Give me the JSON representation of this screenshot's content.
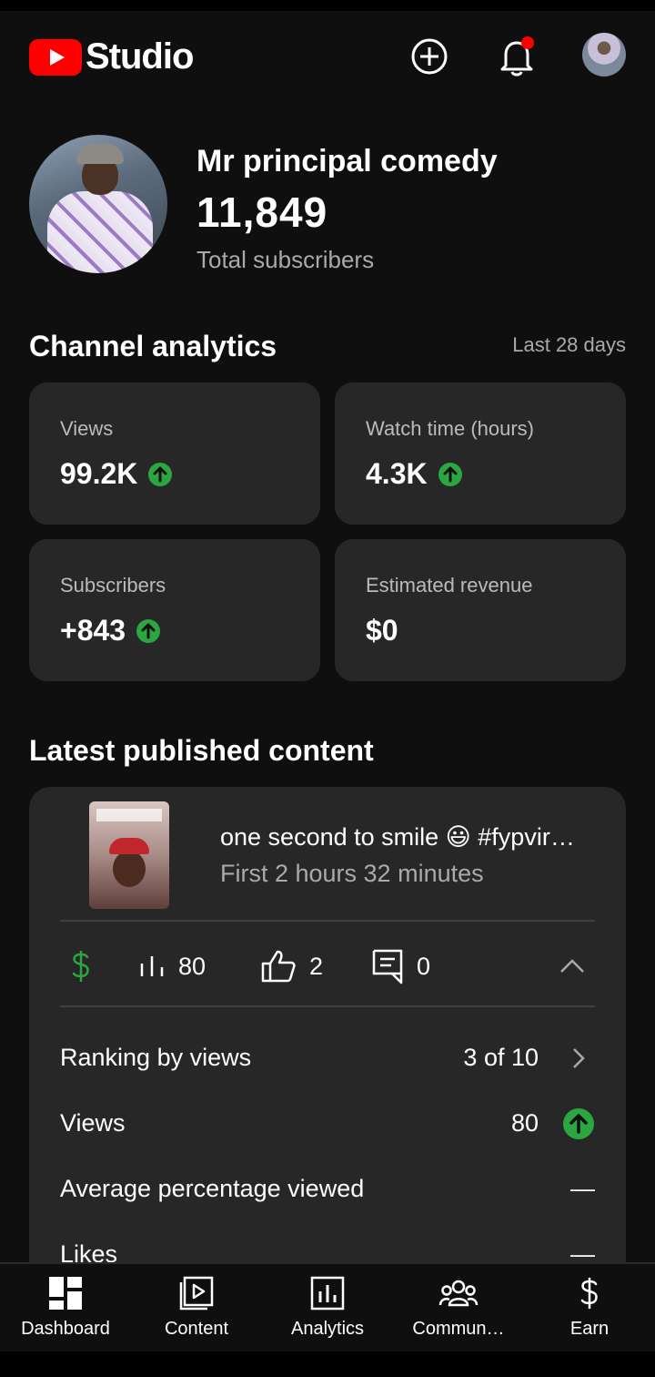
{
  "app": {
    "name": "Studio"
  },
  "channel": {
    "name": "Mr principal comedy",
    "subscriber_count": "11,849",
    "subscriber_label": "Total subscribers"
  },
  "analytics": {
    "title": "Channel analytics",
    "period": "Last 28 days",
    "cards": [
      {
        "label": "Views",
        "value": "99.2K",
        "trend": "up"
      },
      {
        "label": "Watch time (hours)",
        "value": "4.3K",
        "trend": "up"
      },
      {
        "label": "Subscribers",
        "value": "+843",
        "trend": "up"
      },
      {
        "label": "Estimated revenue",
        "value": "$0",
        "trend": "none"
      }
    ]
  },
  "latest": {
    "title": "Latest published content",
    "video": {
      "title": "one second to smile 😃 #fypvir…",
      "subtitle": "First 2 hours 32 minutes",
      "views": "80",
      "likes": "2",
      "comments": "0"
    },
    "rows": [
      {
        "label": "Ranking by views",
        "value": "3 of 10",
        "icon": "chevron-right-icon"
      },
      {
        "label": "Views",
        "value": "80",
        "icon": "arrow-up-icon"
      },
      {
        "label": "Average percentage viewed",
        "value": "—",
        "icon": ""
      },
      {
        "label": "Likes",
        "value": "—",
        "icon": ""
      }
    ]
  },
  "nav": [
    {
      "label": "Dashboard",
      "icon": "dashboard-icon"
    },
    {
      "label": "Content",
      "icon": "content-icon"
    },
    {
      "label": "Analytics",
      "icon": "analytics-icon"
    },
    {
      "label": "Commun…",
      "icon": "community-icon"
    },
    {
      "label": "Earn",
      "icon": "dollar-icon"
    }
  ],
  "colors": {
    "background": "#0f0f0f",
    "card": "#272727",
    "accent_red": "#ff0000",
    "trend_green": "#2ba640",
    "muted_text": "#aaaaaa"
  }
}
